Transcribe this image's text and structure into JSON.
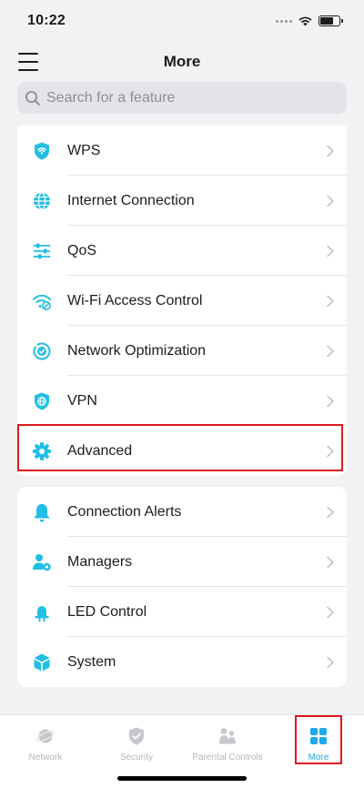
{
  "status_bar": {
    "time": "10:22"
  },
  "header": {
    "title": "More"
  },
  "search": {
    "placeholder": "Search for a feature"
  },
  "colors": {
    "accent": "#21bfe4",
    "active_tab": "#1fa9e6",
    "highlight": "#e0191f"
  },
  "group1": [
    {
      "label": "WPS",
      "icon": "wps-shield-icon"
    },
    {
      "label": "Internet Connection",
      "icon": "globe-icon"
    },
    {
      "label": "QoS",
      "icon": "sliders-icon"
    },
    {
      "label": "Wi-Fi Access Control",
      "icon": "wifi-block-icon"
    },
    {
      "label": "Network Optimization",
      "icon": "optimization-icon"
    },
    {
      "label": "VPN",
      "icon": "vpn-shield-icon"
    },
    {
      "label": "Advanced",
      "icon": "gear-icon"
    }
  ],
  "group2": [
    {
      "label": "Connection Alerts",
      "icon": "bell-icon"
    },
    {
      "label": "Managers",
      "icon": "managers-icon"
    },
    {
      "label": "LED Control",
      "icon": "led-icon"
    },
    {
      "label": "System",
      "icon": "cube-icon"
    }
  ],
  "tabs": [
    {
      "label": "Network",
      "icon": "planet-icon",
      "active": false
    },
    {
      "label": "Security",
      "icon": "shield-check-icon",
      "active": false
    },
    {
      "label": "Parental Controls",
      "icon": "family-icon",
      "active": false
    },
    {
      "label": "More",
      "icon": "grid-icon",
      "active": true
    }
  ]
}
